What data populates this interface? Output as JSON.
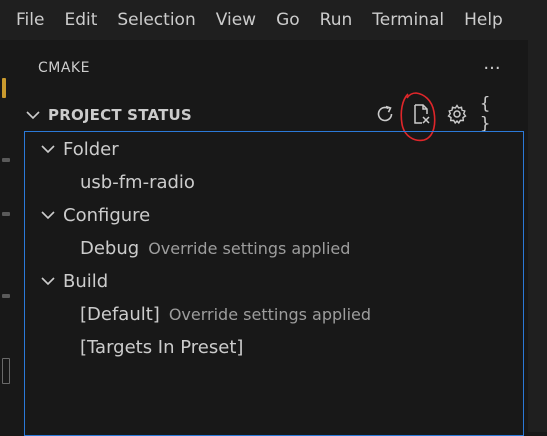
{
  "menubar": {
    "items": [
      "File",
      "Edit",
      "Selection",
      "View",
      "Go",
      "Run",
      "Terminal",
      "Help"
    ]
  },
  "view": {
    "title": "CMAKE",
    "more_icon": "ellipsis-icon"
  },
  "section": {
    "title": "PROJECT STATUS",
    "actions": [
      {
        "name": "refresh-icon"
      },
      {
        "name": "clear-file-icon"
      },
      {
        "name": "gear-icon"
      },
      {
        "name": "braces-icon",
        "glyph": "{ }"
      }
    ]
  },
  "tree": {
    "folder": {
      "label": "Folder",
      "child": "usb-fm-radio"
    },
    "configure": {
      "label": "Configure",
      "child": "Debug",
      "child_desc": "Override settings applied"
    },
    "build": {
      "label": "Build",
      "child1": "[Default]",
      "child1_desc": "Override settings applied",
      "child2": "[Targets In Preset]"
    }
  },
  "colors": {
    "focus_border": "#2b79d8",
    "annotation": "#e0262a"
  }
}
